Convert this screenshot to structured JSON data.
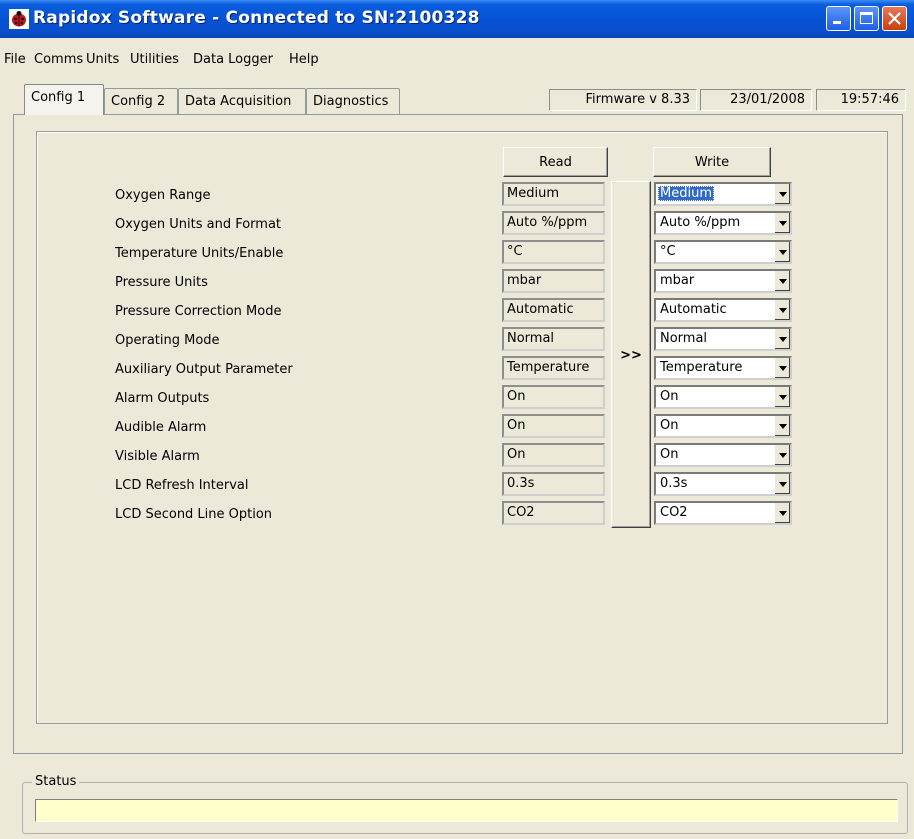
{
  "window": {
    "title": "Rapidox Software - Connected to SN:2100328"
  },
  "menu": [
    "File",
    "Comms",
    "Units",
    "Utilities",
    "Data Logger",
    "Help"
  ],
  "tabs": [
    "Config 1",
    "Config 2",
    "Data Acquisition",
    "Diagnostics"
  ],
  "info": {
    "firmware": "Firmware v 8.33",
    "date": "23/01/2008",
    "time": "19:57:46"
  },
  "buttons": {
    "read": "Read",
    "write": "Write",
    "copy": ">>"
  },
  "rows": [
    {
      "label": "Oxygen Range",
      "read": "Medium",
      "write": "Medium"
    },
    {
      "label": "Oxygen Units and Format",
      "read": "Auto %/ppm",
      "write": "Auto %/ppm"
    },
    {
      "label": "Temperature Units/Enable",
      "read": "°C",
      "write": "°C"
    },
    {
      "label": "Pressure Units",
      "read": "mbar",
      "write": "mbar"
    },
    {
      "label": "Pressure Correction Mode",
      "read": "Automatic",
      "write": "Automatic"
    },
    {
      "label": "Operating Mode",
      "read": "Normal",
      "write": "Normal"
    },
    {
      "label": "Auxiliary Output Parameter",
      "read": "Temperature",
      "write": "Temperature"
    },
    {
      "label": "Alarm Outputs",
      "read": "On",
      "write": "On"
    },
    {
      "label": "Audible Alarm",
      "read": "On",
      "write": "On"
    },
    {
      "label": "Visible Alarm",
      "read": "On",
      "write": "On"
    },
    {
      "label": "LCD Refresh Interval",
      "read": "0.3s",
      "write": "0.3s"
    },
    {
      "label": "LCD Second Line Option",
      "read": "CO2",
      "write": "CO2"
    }
  ],
  "status": {
    "label": "Status",
    "text": ""
  }
}
